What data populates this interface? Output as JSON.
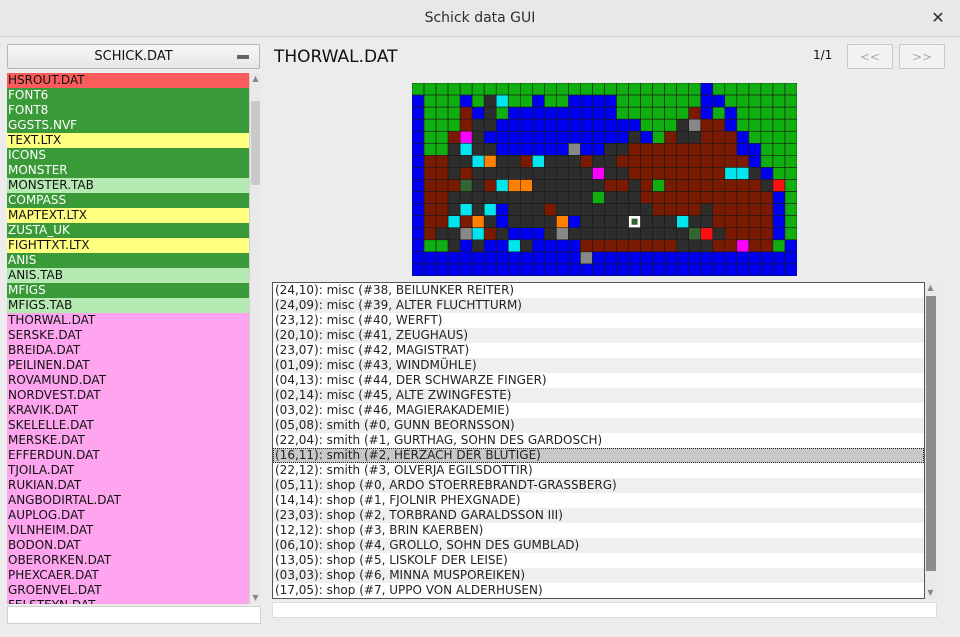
{
  "window": {
    "title": "Schick data GUI"
  },
  "left_panel": {
    "file_selector": {
      "value": "SCHICK.DAT"
    },
    "files": [
      {
        "name": "HSROUT.DAT",
        "color": "red"
      },
      {
        "name": "FONT6",
        "color": "green"
      },
      {
        "name": "FONT8",
        "color": "green"
      },
      {
        "name": "GGSTS.NVF",
        "color": "green"
      },
      {
        "name": "TEXT.LTX",
        "color": "yellow"
      },
      {
        "name": "ICONS",
        "color": "green"
      },
      {
        "name": "MONSTER",
        "color": "green"
      },
      {
        "name": "MONSTER.TAB",
        "color": "lightgreen"
      },
      {
        "name": "COMPASS",
        "color": "green"
      },
      {
        "name": "MAPTEXT.LTX",
        "color": "yellow"
      },
      {
        "name": "ZUSTA_UK",
        "color": "green"
      },
      {
        "name": "FIGHTTXT.LTX",
        "color": "yellow"
      },
      {
        "name": "ANIS",
        "color": "green"
      },
      {
        "name": "ANIS.TAB",
        "color": "lightgreen"
      },
      {
        "name": "MFIGS",
        "color": "green"
      },
      {
        "name": "MFIGS.TAB",
        "color": "lightgreen"
      },
      {
        "name": "THORWAL.DAT",
        "color": "pink"
      },
      {
        "name": "SERSKE.DAT",
        "color": "pink"
      },
      {
        "name": "BREIDA.DAT",
        "color": "pink"
      },
      {
        "name": "PEILINEN.DAT",
        "color": "pink"
      },
      {
        "name": "ROVAMUND.DAT",
        "color": "pink"
      },
      {
        "name": "NORDVEST.DAT",
        "color": "pink"
      },
      {
        "name": "KRAVIK.DAT",
        "color": "pink"
      },
      {
        "name": "SKELELLE.DAT",
        "color": "pink"
      },
      {
        "name": "MERSKE.DAT",
        "color": "pink"
      },
      {
        "name": "EFFERDUN.DAT",
        "color": "pink"
      },
      {
        "name": "TJOILA.DAT",
        "color": "pink"
      },
      {
        "name": "RUKIAN.DAT",
        "color": "pink"
      },
      {
        "name": "ANGBODIRTAL.DAT",
        "color": "pink"
      },
      {
        "name": "AUPLOG.DAT",
        "color": "pink"
      },
      {
        "name": "VILNHEIM.DAT",
        "color": "pink"
      },
      {
        "name": "BODON.DAT",
        "color": "pink"
      },
      {
        "name": "OBERORKEN.DAT",
        "color": "pink"
      },
      {
        "name": "PHEXCAER.DAT",
        "color": "pink"
      },
      {
        "name": "GROENVEL.DAT",
        "color": "pink"
      },
      {
        "name": "FELSTEYN.DAT",
        "color": "pink"
      }
    ],
    "filter_input": {
      "value": ""
    }
  },
  "right_panel": {
    "archive_title": "THORWAL.DAT",
    "page_indicator": "1/1",
    "prev_label": "<<",
    "next_label": ">>",
    "map": {
      "cols": 32,
      "rows": 16,
      "palette": {
        "G": "#0faf0f",
        "B": "#0000f0",
        "D": "#2d2d2d",
        "R": "#7a1a00",
        "C": "#00e5ee",
        "O": "#ff8000",
        "M": "#ff00ff",
        "Y": "#888888",
        "E": "#ff1010",
        "L": "#336633",
        "W": "#ffffff"
      },
      "grid": [
        "GGGGGGGGGGGGGGGGGGGGGGGGBGGGGGGG",
        "BGGGBGDCGGBGGBBBBGGGGGGGBBGGGGGG",
        "BGGGRBDGBBBBBBBBBGGGGGGRBGBGGGGG",
        "BGGGRDDBBBBBBBBBBBBGGGDYRRBGGGGG",
        "BGGRMDBBBBBBBBBBBBDBGRDDRRRBGGGG",
        "BGGDCDDBBBBBBYBBDDRRRRRRRRRBBGGG",
        "BRRDDCODDRCDDDRDDRRRRRRRRRRRBGGG",
        "BRRDRDDDDDDDDDDMDDRRRRRRRRCCDBGG",
        "BRRRLDRCOODDDDDDRRDRGRRRRRRRRDEG",
        "BRRDDDDDDDDDDDDGDDDRRRRRRRRRRRBG",
        "BRRDCDCBDDDRDDDDDDDDRRRRDRRRRRBG",
        "BRRCRODBDDDDOBDDDDWDDDCDDRRRRRBG",
        "BRDDYCRDBBBDYDDDDDDDDDDLEDRRRRBG",
        "BGGDBDBBCDBBBBRRRRRRRRDDDRRMRRGB",
        "BBBBBBBBBBBBBBYBBBBBBBBBBBBBBBBB",
        "BBBBBBBBBBBBBBBBBBBBBBBBBBBBBBBB"
      ],
      "selected_cell": "(16,11)"
    },
    "entries": [
      {
        "text": "(24,10): misc (#38, BEILUNKER REITER)"
      },
      {
        "text": "(24,09): misc (#39, ALTER FLUCHTTURM)"
      },
      {
        "text": "(23,12): misc (#40, WERFT)"
      },
      {
        "text": "(20,10): misc (#41, ZEUGHAUS)"
      },
      {
        "text": "(23,07): misc (#42, MAGISTRAT)"
      },
      {
        "text": "(01,09): misc (#43, WINDMÜHLE)"
      },
      {
        "text": "(04,13): misc (#44, DER SCHWARZE FINGER)"
      },
      {
        "text": "(02,14): misc (#45, ALTE ZWINGFESTE)"
      },
      {
        "text": "(03,02): misc (#46, MAGIERAKADEMIE)"
      },
      {
        "text": "(05,08): smith (#0, GUNN BEORNSSON)"
      },
      {
        "text": "(22,04): smith (#1, GURTHAG, SOHN DES GARDOSCH)"
      },
      {
        "text": "(16,11): smith (#2, HERZACH DER BLUTIGE)",
        "selected": true
      },
      {
        "text": "(22,12): smith (#3, OLVERJA EGILSDOTTIR)"
      },
      {
        "text": "(05,11): shop (#0, ARDO STOERREBRANDT-GRASSBERG)"
      },
      {
        "text": "(14,14): shop (#1, FJOLNIR PHEXGNADE)"
      },
      {
        "text": "(23,03): shop (#2, TORBRAND GARALDSSON III)"
      },
      {
        "text": "(12,12): shop (#3, BRIN KAERBEN)"
      },
      {
        "text": "(06,10): shop (#4, GROLLO, SOHN DES GUMBLAD)"
      },
      {
        "text": "(13,05): shop (#5, LISKOLF DER LEISE)"
      },
      {
        "text": "(03,03): shop (#6, MINNA MUSPOREIKEN)"
      },
      {
        "text": "(17,05): shop (#7, UPPO VON ALDERHUSEN)"
      }
    ],
    "detail_input": {
      "value": ""
    }
  }
}
